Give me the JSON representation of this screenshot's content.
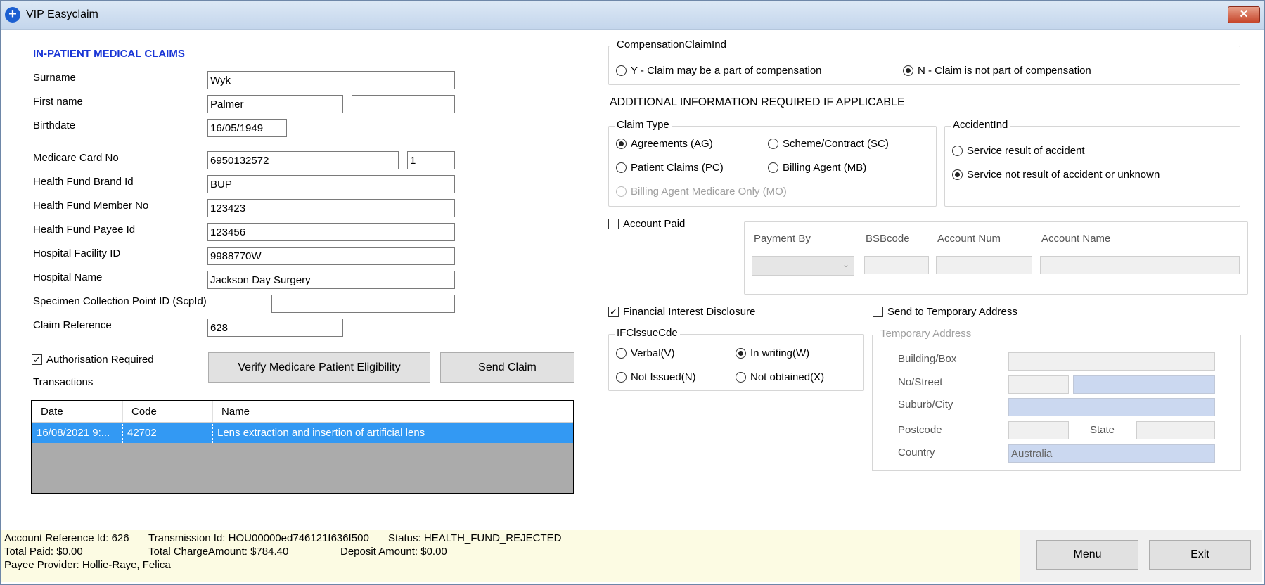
{
  "window": {
    "title": "VIP Easyclaim",
    "close_label": "✕"
  },
  "form": {
    "heading": "IN-PATIENT MEDICAL CLAIMS",
    "surname_label": "Surname",
    "surname": "Wyk",
    "first_name_label": "First name",
    "first_name": "Palmer",
    "middle_name": "",
    "birthdate_label": "Birthdate",
    "birthdate": "16/05/1949",
    "medicare_label": "Medicare Card No",
    "medicare_no": "6950132572",
    "medicare_irn": "1",
    "hf_brand_label": "Health Fund Brand Id",
    "hf_brand": "BUP",
    "hf_member_label": "Health Fund Member No",
    "hf_member": "123423",
    "hf_payee_label": "Health Fund Payee Id",
    "hf_payee": "123456",
    "facility_label": "Hospital Facility ID",
    "facility_id": "9988770W",
    "hospital_name_label": "Hospital Name",
    "hospital_name": "Jackson Day Surgery",
    "specimen_label": "Specimen Collection Point ID (ScpId)",
    "specimen": "",
    "claim_ref_label": "Claim Reference",
    "claim_ref": "628",
    "auth_required_label": "Authorisation Required",
    "auth_required_checked": true,
    "transactions_label": "Transactions",
    "verify_button": "Verify Medicare Patient Eligibility",
    "send_button": "Send Claim"
  },
  "transactions": {
    "columns": [
      "Date",
      "Code",
      "Name"
    ],
    "rows": [
      {
        "date": "16/08/2021 9:...",
        "code": "42702",
        "name": "Lens extraction and insertion of artificial lens"
      }
    ]
  },
  "compensation": {
    "title": "CompensationClaimInd",
    "option_y": "Y - Claim may be a part of compensation",
    "option_n": "N - Claim is not part of compensation",
    "selected": "N"
  },
  "additional_info": "ADDITIONAL INFORMATION REQUIRED IF APPLICABLE",
  "claim_type": {
    "title": "Claim Type",
    "ag": "Agreements (AG)",
    "sc": "Scheme/Contract (SC)",
    "pc": "Patient Claims (PC)",
    "mb": "Billing Agent (MB)",
    "mo": "Billing Agent Medicare Only (MO)",
    "selected": "AG"
  },
  "accident": {
    "title": "AccidentInd",
    "yes": "Service result of accident",
    "no": "Service not result of accident or unknown",
    "selected": "no"
  },
  "account_paid": {
    "label": "Account Paid",
    "checked": false,
    "payment_by_label": "Payment By",
    "bsb_label": "BSBcode",
    "account_num_label": "Account Num",
    "account_name_label": "Account Name"
  },
  "financial_interest": {
    "label": "Financial Interest Disclosure",
    "checked": true
  },
  "ifc_issue": {
    "title": "IFClssueCde",
    "verbal": "Verbal(V)",
    "writing": "In writing(W)",
    "not_issued": "Not Issued(N)",
    "not_obtained": "Not obtained(X)",
    "selected": "writing"
  },
  "temp_address": {
    "send_label": "Send to Temporary Address",
    "send_checked": false,
    "title": "Temporary Address",
    "building_label": "Building/Box",
    "street_label": "No/Street",
    "suburb_label": "Suburb/City",
    "postcode_label": "Postcode",
    "state_label": "State",
    "country_label": "Country",
    "country": "Australia"
  },
  "status_bar": {
    "account_ref": "Account Reference Id: 626",
    "transmission": "Transmission Id: HOU00000ed746121f636f500",
    "status": "Status: HEALTH_FUND_REJECTED",
    "total_paid": "Total Paid: $0.00",
    "total_charge": "Total ChargeAmount: $784.40",
    "deposit": "Deposit Amount: $0.00",
    "payee": "Payee Provider: Hollie-Raye, Felica"
  },
  "buttons": {
    "menu": "Menu",
    "exit": "Exit"
  },
  "colors": {
    "heading": "#1a36d6",
    "selected_row": "#3399f3",
    "status_bg": "#fcfbe3"
  }
}
